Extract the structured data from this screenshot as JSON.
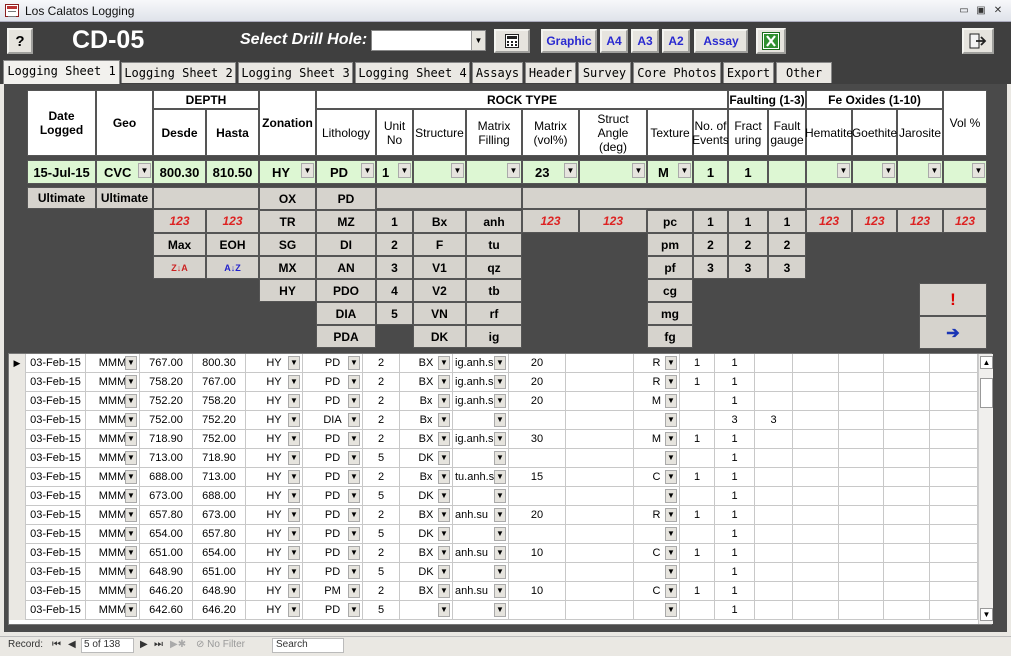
{
  "window": {
    "title": "Los Calatos Logging",
    "minimize": "▭",
    "restore": "▣",
    "close": "✕"
  },
  "toolbar": {
    "help": "?",
    "hole_code": "CD-05",
    "select_label": "Select Drill Hole:",
    "hole_value": "",
    "graphic": "Graphic",
    "a4": "A4",
    "a3": "A3",
    "a2": "A2",
    "assay": "Assay"
  },
  "tabs": [
    "Logging Sheet 1",
    "Logging Sheet 2",
    "Logging Sheet 3",
    "Logging Sheet 4",
    "Assays",
    "Header",
    "Survey",
    "Core Photos",
    "Export",
    "Other"
  ],
  "header": {
    "depth": "DEPTH",
    "rock_type": "ROCK TYPE",
    "faulting": "Faulting (1-3)",
    "fe_oxides": "Fe Oxides (1-10)",
    "date_logged": "Date Logged",
    "geo": "Geo",
    "desde": "Desde",
    "hasta": "Hasta",
    "zonation": "Zonation",
    "lithology": "Lithology",
    "unit_no": "Unit No",
    "structure": "Structure",
    "matrix_filling": "Matrix Filling",
    "matrix_vol": "Matrix (vol%)",
    "struct_angle": "Struct Angle (deg)",
    "texture": "Texture",
    "no_events": "No. of Events",
    "fracturing": "Fract uring",
    "fault_gauge": "Fault gauge",
    "hematite": "Hematite",
    "goethite": "Goethite",
    "jarosite": "Jarosite",
    "vol_pct": "Vol %"
  },
  "entry": {
    "date": "15-Jul-15",
    "geo": "CVC",
    "desde": "800.30",
    "hasta": "810.50",
    "zonation": "HY",
    "lithology": "PD",
    "unit": "1",
    "structure": "",
    "filling": "",
    "matrix": "23",
    "angle": "",
    "texture": "M",
    "events": "1",
    "fract": "1",
    "fault": "",
    "hematite": "",
    "goethite": "",
    "jarosite": "",
    "vol": ""
  },
  "lookup": {
    "ultimate": "Ultimate",
    "red123": "123",
    "max": "Max",
    "eoh": "EOH",
    "sort_za": "Z↓A",
    "sort_az": "A↓Z",
    "zonation": [
      "OX",
      "TR",
      "SG",
      "MX",
      "HY"
    ],
    "lithology": [
      "PD",
      "MZ",
      "DI",
      "AN",
      "PDO",
      "DIA",
      "PDA"
    ],
    "unit": [
      "1",
      "2",
      "3",
      "4",
      "5"
    ],
    "structure": [
      "Bx",
      "F",
      "V1",
      "V2",
      "VN",
      "DK"
    ],
    "filling": [
      "anh",
      "tu",
      "qz",
      "tb",
      "rf",
      "ig"
    ],
    "texture": [
      "pc",
      "pm",
      "pf",
      "cg",
      "mg",
      "fg"
    ],
    "events": [
      "1",
      "2",
      "3"
    ],
    "fract": [
      "1",
      "2",
      "3"
    ],
    "fault": [
      "1",
      "2",
      "3"
    ],
    "alert": "!",
    "arrow": "➔"
  },
  "rows": [
    {
      "date": "03-Feb-15",
      "geo": "MMM",
      "desde": "767.00",
      "hasta": "800.30",
      "zon": "HY",
      "lith": "PD",
      "unit": "2",
      "struct": "BX",
      "fill": "ig.anh.su",
      "mat": "20",
      "ang": "",
      "tex": "R",
      "ev": "1",
      "fr": "1",
      "fg": ""
    },
    {
      "date": "03-Feb-15",
      "geo": "MMM",
      "desde": "758.20",
      "hasta": "767.00",
      "zon": "HY",
      "lith": "PD",
      "unit": "2",
      "struct": "BX",
      "fill": "ig.anh.su",
      "mat": "20",
      "ang": "",
      "tex": "R",
      "ev": "1",
      "fr": "1",
      "fg": ""
    },
    {
      "date": "03-Feb-15",
      "geo": "MMM",
      "desde": "752.20",
      "hasta": "758.20",
      "zon": "HY",
      "lith": "PD",
      "unit": "2",
      "struct": "Bx",
      "fill": "ig.anh.su",
      "mat": "20",
      "ang": "",
      "tex": "M",
      "ev": "",
      "fr": "1",
      "fg": ""
    },
    {
      "date": "03-Feb-15",
      "geo": "MMM",
      "desde": "752.00",
      "hasta": "752.20",
      "zon": "HY",
      "lith": "DIA",
      "unit": "2",
      "struct": "Bx",
      "fill": "",
      "mat": "",
      "ang": "",
      "tex": "",
      "ev": "",
      "fr": "3",
      "fg": "3"
    },
    {
      "date": "03-Feb-15",
      "geo": "MMM",
      "desde": "718.90",
      "hasta": "752.00",
      "zon": "HY",
      "lith": "PD",
      "unit": "2",
      "struct": "BX",
      "fill": "ig.anh.su",
      "mat": "30",
      "ang": "",
      "tex": "M",
      "ev": "1",
      "fr": "1",
      "fg": ""
    },
    {
      "date": "03-Feb-15",
      "geo": "MMM",
      "desde": "713.00",
      "hasta": "718.90",
      "zon": "HY",
      "lith": "PD",
      "unit": "5",
      "struct": "DK",
      "fill": "",
      "mat": "",
      "ang": "",
      "tex": "",
      "ev": "",
      "fr": "1",
      "fg": ""
    },
    {
      "date": "03-Feb-15",
      "geo": "MMM",
      "desde": "688.00",
      "hasta": "713.00",
      "zon": "HY",
      "lith": "PD",
      "unit": "2",
      "struct": "Bx",
      "fill": "tu.anh.su",
      "mat": "15",
      "ang": "",
      "tex": "C",
      "ev": "1",
      "fr": "1",
      "fg": ""
    },
    {
      "date": "03-Feb-15",
      "geo": "MMM",
      "desde": "673.00",
      "hasta": "688.00",
      "zon": "HY",
      "lith": "PD",
      "unit": "5",
      "struct": "DK",
      "fill": "",
      "mat": "",
      "ang": "",
      "tex": "",
      "ev": "",
      "fr": "1",
      "fg": ""
    },
    {
      "date": "03-Feb-15",
      "geo": "MMM",
      "desde": "657.80",
      "hasta": "673.00",
      "zon": "HY",
      "lith": "PD",
      "unit": "2",
      "struct": "BX",
      "fill": "anh.su",
      "mat": "20",
      "ang": "",
      "tex": "R",
      "ev": "1",
      "fr": "1",
      "fg": ""
    },
    {
      "date": "03-Feb-15",
      "geo": "MMM",
      "desde": "654.00",
      "hasta": "657.80",
      "zon": "HY",
      "lith": "PD",
      "unit": "5",
      "struct": "DK",
      "fill": "",
      "mat": "",
      "ang": "",
      "tex": "",
      "ev": "",
      "fr": "1",
      "fg": ""
    },
    {
      "date": "03-Feb-15",
      "geo": "MMM",
      "desde": "651.00",
      "hasta": "654.00",
      "zon": "HY",
      "lith": "PD",
      "unit": "2",
      "struct": "BX",
      "fill": "anh.su",
      "mat": "10",
      "ang": "",
      "tex": "C",
      "ev": "1",
      "fr": "1",
      "fg": ""
    },
    {
      "date": "03-Feb-15",
      "geo": "MMM",
      "desde": "648.90",
      "hasta": "651.00",
      "zon": "HY",
      "lith": "PD",
      "unit": "5",
      "struct": "DK",
      "fill": "",
      "mat": "",
      "ang": "",
      "tex": "",
      "ev": "",
      "fr": "1",
      "fg": ""
    },
    {
      "date": "03-Feb-15",
      "geo": "MMM",
      "desde": "646.20",
      "hasta": "648.90",
      "zon": "HY",
      "lith": "PM",
      "unit": "2",
      "struct": "BX",
      "fill": "anh.su",
      "mat": "10",
      "ang": "",
      "tex": "C",
      "ev": "1",
      "fr": "1",
      "fg": ""
    },
    {
      "date": "03-Feb-15",
      "geo": "MMM",
      "desde": "642.60",
      "hasta": "646.20",
      "zon": "HY",
      "lith": "PD",
      "unit": "5",
      "struct": "",
      "fill": "",
      "mat": "",
      "ang": "",
      "tex": "",
      "ev": "",
      "fr": "1",
      "fg": ""
    }
  ],
  "status": {
    "record_label": "Record:",
    "record_value": "5 of 138",
    "filter": "No Filter",
    "search": "Search"
  }
}
